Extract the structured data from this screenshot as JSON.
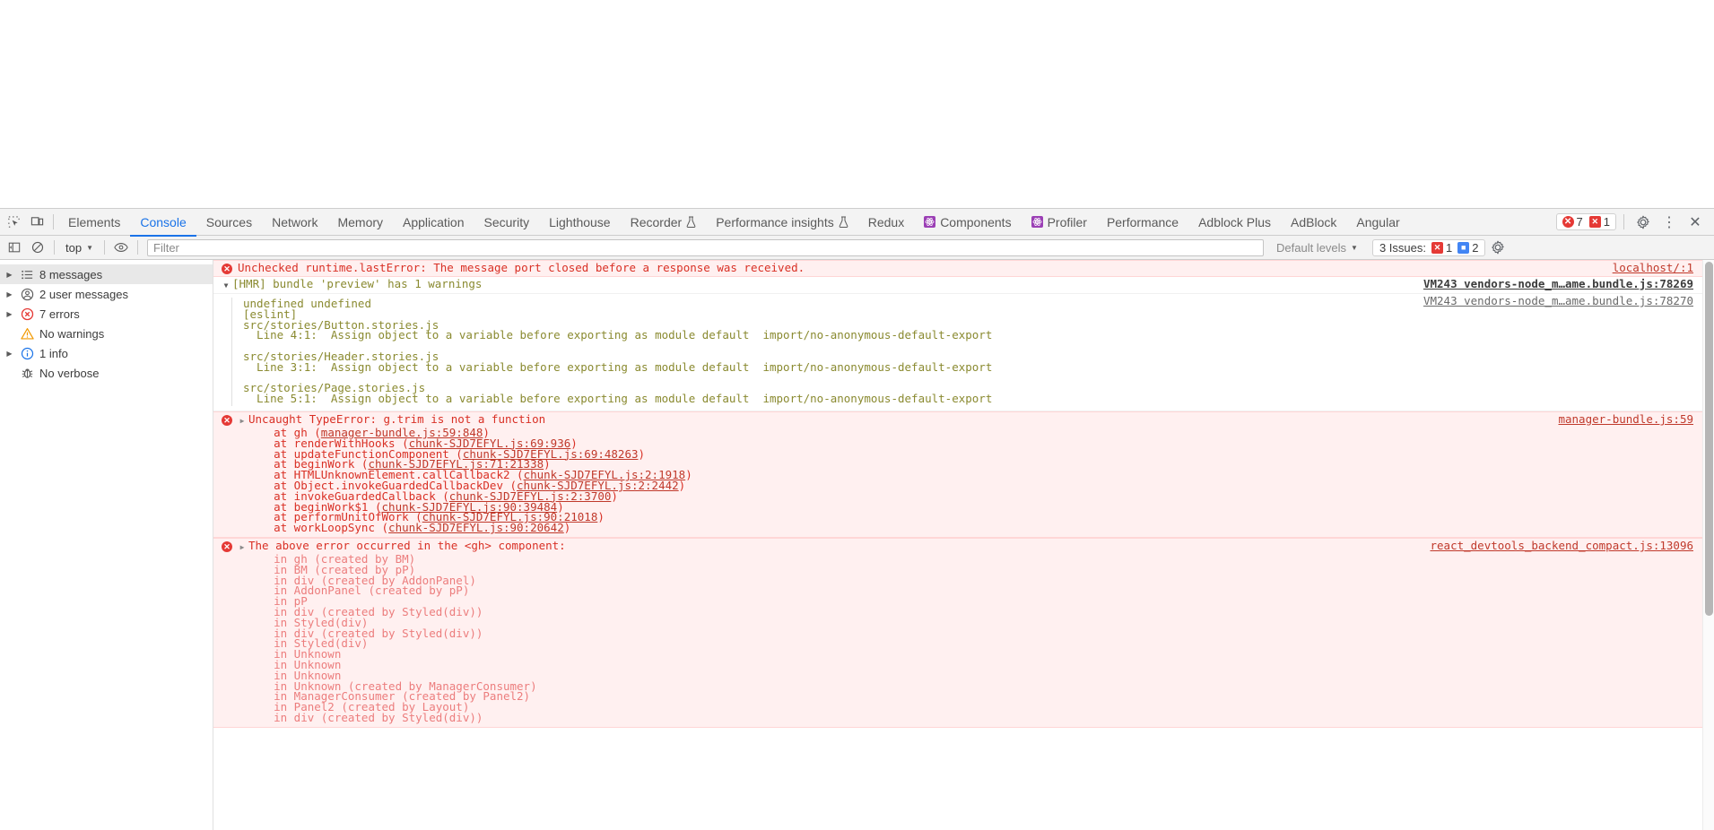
{
  "window": {
    "title": "Chrome DevTools - Console"
  },
  "tabbar": {
    "inspect_icon": "inspect-cursor-icon",
    "device_icon": "device-toolbar-icon",
    "tabs": [
      {
        "label": "Elements",
        "active": false,
        "icon": null
      },
      {
        "label": "Console",
        "active": true,
        "icon": null
      },
      {
        "label": "Sources",
        "active": false,
        "icon": null
      },
      {
        "label": "Network",
        "active": false,
        "icon": null
      },
      {
        "label": "Memory",
        "active": false,
        "icon": null
      },
      {
        "label": "Application",
        "active": false,
        "icon": null
      },
      {
        "label": "Security",
        "active": false,
        "icon": null
      },
      {
        "label": "Lighthouse",
        "active": false,
        "icon": null
      },
      {
        "label": "Recorder",
        "active": false,
        "icon": "beaker-icon"
      },
      {
        "label": "Performance insights",
        "active": false,
        "icon": "beaker-icon"
      },
      {
        "label": "Redux",
        "active": false,
        "icon": null
      },
      {
        "label": "Components",
        "active": false,
        "icon": "react-logo-icon"
      },
      {
        "label": "Profiler",
        "active": false,
        "icon": "react-logo-icon"
      },
      {
        "label": "Performance",
        "active": false,
        "icon": null
      },
      {
        "label": "Adblock Plus",
        "active": false,
        "icon": null
      },
      {
        "label": "AdBlock",
        "active": false,
        "icon": null
      },
      {
        "label": "Angular",
        "active": false,
        "icon": null
      }
    ],
    "error_count": "7",
    "warning_count": "1",
    "settings_icon": "gear-icon",
    "more_icon": "more-vertical-icon",
    "close_icon": "close-icon"
  },
  "console_toolbar": {
    "sidebar_toggle_icon": "show-console-sidebar-icon",
    "clear_icon": "clear-console-icon",
    "context": "top",
    "eye_icon": "live-expression-icon",
    "filter_value": "",
    "filter_placeholder": "Filter",
    "levels_label": "Default levels",
    "issues_label": "3 Issues:",
    "issues_error_count": "1",
    "issues_info_count": "2",
    "settings_icon": "gear-icon"
  },
  "sidebar": {
    "items": [
      {
        "label": "8 messages",
        "icon": "list-icon",
        "expandable": true,
        "selected": true
      },
      {
        "label": "2 user messages",
        "icon": "user-icon",
        "expandable": true,
        "selected": false
      },
      {
        "label": "7 errors",
        "icon": "error-circle-icon",
        "expandable": true,
        "selected": false
      },
      {
        "label": "No warnings",
        "icon": "warning-triangle-icon",
        "expandable": false,
        "selected": false
      },
      {
        "label": "1 info",
        "icon": "info-circle-icon",
        "expandable": true,
        "selected": false
      },
      {
        "label": "No verbose",
        "icon": "bug-icon",
        "expandable": false,
        "selected": false
      }
    ]
  },
  "console_log": {
    "messages": [
      {
        "id": "m1",
        "kind": "error",
        "text": "Unchecked runtime.lastError: The message port closed before a response was received.",
        "source": "localhost/:1",
        "icon": "error-circle-icon"
      },
      {
        "id": "m2",
        "kind": "warning-group",
        "text": "[HMR] bundle 'preview' has 1 warnings",
        "source": "VM243 vendors-node_m…ame.bundle.js:78269",
        "disclosure": "open"
      },
      {
        "id": "m3",
        "kind": "eslint-detail",
        "source": "VM243 vendors-node_m…ame.bundle.js:78270",
        "lines": [
          "undefined undefined",
          "[eslint]",
          "src/stories/Button.stories.js",
          "  Line 4:1:  Assign object to a variable before exporting as module default  import/no-anonymous-default-export",
          "",
          "src/stories/Header.stories.js",
          "  Line 3:1:  Assign object to a variable before exporting as module default  import/no-anonymous-default-export",
          "",
          "src/stories/Page.stories.js",
          "  Line 5:1:  Assign object to a variable before exporting as module default  import/no-anonymous-default-export"
        ]
      },
      {
        "id": "m4",
        "kind": "error-stack",
        "text": "Uncaught TypeError: g.trim is not a function",
        "source": "manager-bundle.js:59",
        "icon": "error-circle-icon",
        "disclosure": "closed",
        "frames": [
          {
            "prefix": "    at gh (",
            "link": "manager-bundle.js:59:848",
            "suffix": ")"
          },
          {
            "prefix": "    at renderWithHooks (",
            "link": "chunk-SJD7EFYL.js:69:936",
            "suffix": ")"
          },
          {
            "prefix": "    at updateFunctionComponent (",
            "link": "chunk-SJD7EFYL.js:69:48263",
            "suffix": ")"
          },
          {
            "prefix": "    at beginWork (",
            "link": "chunk-SJD7EFYL.js:71:21338",
            "suffix": ")"
          },
          {
            "prefix": "    at HTMLUnknownElement.callCallback2 (",
            "link": "chunk-SJD7EFYL.js:2:1918",
            "suffix": ")"
          },
          {
            "prefix": "    at Object.invokeGuardedCallbackDev (",
            "link": "chunk-SJD7EFYL.js:2:2442",
            "suffix": ")"
          },
          {
            "prefix": "    at invokeGuardedCallback (",
            "link": "chunk-SJD7EFYL.js:2:3700",
            "suffix": ")"
          },
          {
            "prefix": "    at beginWork$1 (",
            "link": "chunk-SJD7EFYL.js:90:39484",
            "suffix": ")"
          },
          {
            "prefix": "    at performUnitOfWork (",
            "link": "chunk-SJD7EFYL.js:90:21018",
            "suffix": ")"
          },
          {
            "prefix": "    at workLoopSync (",
            "link": "chunk-SJD7EFYL.js:90:20642",
            "suffix": ")"
          }
        ]
      },
      {
        "id": "m5",
        "kind": "error-component-stack",
        "text": "The above error occurred in the <gh> component:",
        "source": "react_devtools_backend_compact.js:13096",
        "icon": "error-circle-icon",
        "disclosure": "closed",
        "lines": [
          "    in gh (created by BM)",
          "    in BM (created by pP)",
          "    in div (created by AddonPanel)",
          "    in AddonPanel (created by pP)",
          "    in pP",
          "    in div (created by Styled(div))",
          "    in Styled(div)",
          "    in div (created by Styled(div))",
          "    in Styled(div)",
          "    in Unknown",
          "    in Unknown",
          "    in Unknown",
          "    in Unknown (created by ManagerConsumer)",
          "    in ManagerConsumer (created by Panel2)",
          "    in Panel2 (created by Layout)",
          "    in div (created by Styled(div))"
        ]
      }
    ]
  },
  "colors": {
    "error_red": "#d93025",
    "error_bg": "#fff0f0",
    "olive": "#8a8a30",
    "accent_blue": "#1a73e8",
    "react_purple": "#9b3fb5",
    "toolbar_bg": "#f3f3f3"
  }
}
